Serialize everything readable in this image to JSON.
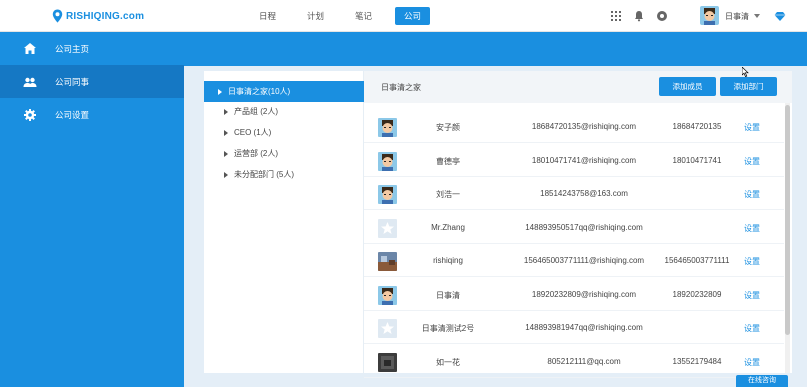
{
  "app": {
    "logo_text": "RISHIQING.com"
  },
  "nav": [
    {
      "label": "日程"
    },
    {
      "label": "计划"
    },
    {
      "label": "笔记"
    },
    {
      "label": "公司"
    }
  ],
  "topbar": {
    "user_name": "日事清",
    "icons": [
      "apps-grid-icon",
      "bell-icon",
      "help-icon",
      "diamond-icon"
    ]
  },
  "sidebar": {
    "items": [
      {
        "label": "公司主页",
        "icon": "home-icon"
      },
      {
        "label": "公司同事",
        "icon": "people-icon"
      },
      {
        "label": "公司设置",
        "icon": "gear-icon"
      }
    ]
  },
  "tree": {
    "items": [
      {
        "label": "日事清之家(10人)"
      },
      {
        "label": "产品组 (2人)"
      },
      {
        "label": "CEO (1人)"
      },
      {
        "label": "运营部 (2人)"
      },
      {
        "label": "未分配部门 (5人)"
      }
    ]
  },
  "dept": {
    "title": "日事清之家",
    "add_member": "添加成员",
    "add_dept": "添加部门"
  },
  "members": [
    {
      "name": "安子颜",
      "email": "18684720135@rishiqing.com",
      "phone": "18684720135",
      "action": "设置",
      "avatar": "face"
    },
    {
      "name": "曹德亭",
      "email": "18010471741@rishiqing.com",
      "phone": "18010471741",
      "action": "设置",
      "avatar": "face"
    },
    {
      "name": "刘浩一",
      "email": "18514243758@163.com",
      "phone": "",
      "action": "设置",
      "avatar": "face"
    },
    {
      "name": "Mr.Zhang",
      "email": "148893950517qq@rishiqing.com",
      "phone": "",
      "action": "设置",
      "avatar": "star"
    },
    {
      "name": "rishiqing",
      "email": "156465003771111@rishiqing.com",
      "phone": "156465003771111",
      "action": "设置",
      "avatar": "photo"
    },
    {
      "name": "日事清",
      "email": "18920232809@rishiqing.com",
      "phone": "18920232809",
      "action": "设置",
      "avatar": "face"
    },
    {
      "name": "日事清测试2号",
      "email": "148893981947qq@rishiqing.com",
      "phone": "",
      "action": "设置",
      "avatar": "star"
    },
    {
      "name": "如一花",
      "email": "805212111@qq.com",
      "phone": "13552179484",
      "action": "设置",
      "avatar": "dark"
    }
  ],
  "online_service": "在线咨询",
  "colors": {
    "accent": "#1a8fe0",
    "sidebar_active": "#1578c4",
    "main_bg": "#e4eef7"
  }
}
